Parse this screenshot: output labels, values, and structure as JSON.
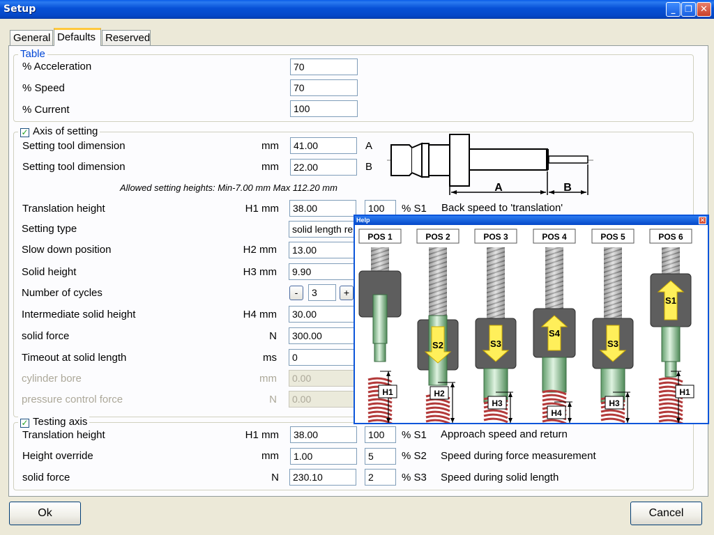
{
  "window": {
    "title": "Setup"
  },
  "tabs": [
    "General",
    "Defaults",
    "Reserved"
  ],
  "active_tab": "Defaults",
  "table_group": {
    "legend": "Table",
    "rows": [
      {
        "label": "% Acceleration",
        "value": "70"
      },
      {
        "label": "% Speed",
        "value": "70"
      },
      {
        "label": "% Current",
        "value": "100"
      }
    ]
  },
  "axis_group": {
    "legend": "Axis of setting",
    "checked": true,
    "tool_rows": [
      {
        "label": "Setting tool dimension",
        "unit": "mm",
        "value": "41.00",
        "tag": "A"
      },
      {
        "label": "Setting tool dimension",
        "unit": "mm",
        "value": "22.00",
        "tag": "B"
      }
    ],
    "allowed_note": "Allowed setting heights: Min-7.00 mm Max 112.20 mm",
    "diagram": {
      "label_a": "A",
      "label_b": "B"
    },
    "translation": {
      "label": "Translation height",
      "unit": "H1 mm",
      "value": "38.00",
      "pct": "100",
      "pct_unit": "% S1",
      "desc": "Back speed to 'translation'"
    },
    "setting_type": {
      "label": "Setting type",
      "value": "solid length re"
    },
    "slow_down": {
      "label": "Slow down position",
      "unit": "H2 mm",
      "value": "13.00"
    },
    "solid_height": {
      "label": "Solid height",
      "unit": "H3 mm",
      "value": "9.90"
    },
    "cycles": {
      "label": "Number of cycles",
      "minus": "-",
      "value": "3",
      "plus": "+"
    },
    "intermediate": {
      "label": "Intermediate solid height",
      "unit": "H4 mm",
      "value": "30.00"
    },
    "solid_force": {
      "label": "solid force",
      "unit": "N",
      "value": "300.00"
    },
    "timeout": {
      "label": "Timeout at solid length",
      "unit": "ms",
      "value": "0"
    },
    "cylinder_bore": {
      "label": "cylinder bore",
      "unit": "mm",
      "value": "0.00"
    },
    "pressure_force": {
      "label": "pressure control force",
      "unit": "N",
      "value": "0.00"
    }
  },
  "testing_group": {
    "legend": "Testing axis",
    "checked": true,
    "rows": [
      {
        "label": "Translation height",
        "unit": "H1 mm",
        "value": "38.00",
        "pct": "100",
        "pct_unit": "% S1",
        "desc": "Approach speed and return"
      },
      {
        "label": "Height override",
        "unit": "mm",
        "value": "1.00",
        "pct": "5",
        "pct_unit": "% S2",
        "desc": "Speed during force measurement"
      },
      {
        "label": "solid force",
        "unit": "N",
        "value": "230.10",
        "pct": "2",
        "pct_unit": "% S3",
        "desc": "Speed during solid length"
      }
    ]
  },
  "help_popup": {
    "title": "Help",
    "close": "x",
    "positions": [
      "POS 1",
      "POS 2",
      "POS 3",
      "POS 4",
      "POS 5",
      "POS 6"
    ],
    "speeds": [
      "S2",
      "S3",
      "S4",
      "S3",
      "S1"
    ],
    "heights": [
      "H1",
      "H2",
      "H3",
      "H4",
      "H3",
      "H1"
    ]
  },
  "buttons": {
    "ok": "Ok",
    "cancel": "Cancel"
  },
  "colors": {
    "titlebar": "#0548c8",
    "dialog_bg": "#ece9d8",
    "panel_bg": "#fcfcfe",
    "legend_blue": "#0046d5",
    "arrow_yellow": "#ffef5a",
    "spring_red": "#b33a3a"
  }
}
